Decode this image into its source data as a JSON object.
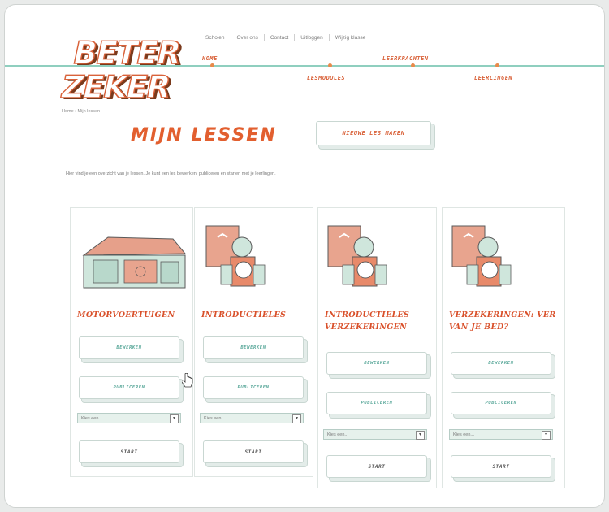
{
  "site": {
    "logo_line1": "BETER",
    "logo_line2": "ZEKER"
  },
  "topnav": [
    "Scholen",
    "Over ons",
    "Contact",
    "Uitloggen",
    "Wijzig klasse"
  ],
  "mainnav": {
    "home": "HOME",
    "lesmodules": "LESMODULES",
    "leerkrachten": "LEERKRACHTEN",
    "leerlingen": "LEERLINGEN"
  },
  "breadcrumb": "Home › Mijn lessen",
  "page_title": "MIJN LESSEN",
  "new_lesson_button": "NIEUWE LES MAKEN",
  "intro_text": "Hier vind je een overzicht van je lessen. Je kunt een les bewerken, publiceren en starten met je leerlingen.",
  "cards": [
    {
      "title": "MOTORVOERTUIGEN",
      "image": "garage-illustration",
      "edit": "BEWERKEN",
      "publish": "PUBLICEREN",
      "select": "Kies een...",
      "start": "START"
    },
    {
      "title": "INTRODUCTIELES",
      "image": "fortune-teller-illustration",
      "edit": "BEWERKEN",
      "publish": "PUBLICEREN",
      "select": "Kies een...",
      "start": "START"
    },
    {
      "title": "INTRODUCTIELES VERZEKERINGEN",
      "image": "fortune-teller-illustration",
      "edit": "BEWERKEN",
      "publish": "PUBLICEREN",
      "select": "Kies een...",
      "start": "START"
    },
    {
      "title": "VERZEKERINGEN: VER VAN JE BED?",
      "image": "fortune-teller-illustration",
      "edit": "BEWERKEN",
      "publish": "PUBLICEREN",
      "select": "Kies een...",
      "start": "START"
    }
  ],
  "colors": {
    "accent": "#e25f2f",
    "teal": "#8fcfbf",
    "select_bg": "#e6f1ec"
  }
}
